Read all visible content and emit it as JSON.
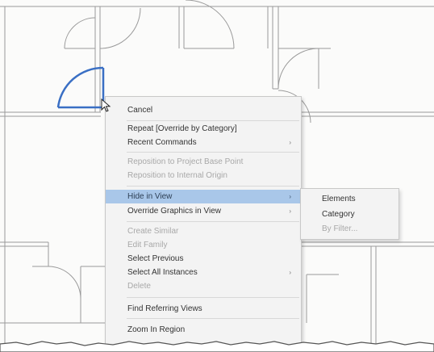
{
  "context_menu": {
    "items": [
      {
        "label": "Cancel",
        "enabled": true,
        "submenu": false
      },
      {
        "label": "Repeat [Override by Category]",
        "enabled": true,
        "submenu": false
      },
      {
        "label": "Recent Commands",
        "enabled": true,
        "submenu": true
      },
      {
        "label": "Reposition to Project Base Point",
        "enabled": false,
        "submenu": false
      },
      {
        "label": "Reposition to Internal Origin",
        "enabled": false,
        "submenu": false
      },
      {
        "label": "Hide in View",
        "enabled": true,
        "submenu": true,
        "highlighted": true
      },
      {
        "label": "Override Graphics in View",
        "enabled": true,
        "submenu": true
      },
      {
        "label": "Create Similar",
        "enabled": false,
        "submenu": false
      },
      {
        "label": "Edit Family",
        "enabled": false,
        "submenu": false
      },
      {
        "label": "Select Previous",
        "enabled": true,
        "submenu": false
      },
      {
        "label": "Select All Instances",
        "enabled": true,
        "submenu": true
      },
      {
        "label": "Delete",
        "enabled": false,
        "submenu": false
      },
      {
        "label": "Find Referring Views",
        "enabled": true,
        "submenu": false
      },
      {
        "label": "Zoom In Region",
        "enabled": true,
        "submenu": false
      }
    ],
    "submenu_arrow": "›"
  },
  "submenu": {
    "items": [
      {
        "label": "Elements",
        "enabled": true
      },
      {
        "label": "Category",
        "enabled": true
      },
      {
        "label": "By Filter...",
        "enabled": false
      }
    ]
  },
  "colors": {
    "highlight": "#a9c7e9",
    "selected_door": "#3a6fc4",
    "disabled_text": "#a8a8a8",
    "menu_bg": "#f3f3f3"
  }
}
